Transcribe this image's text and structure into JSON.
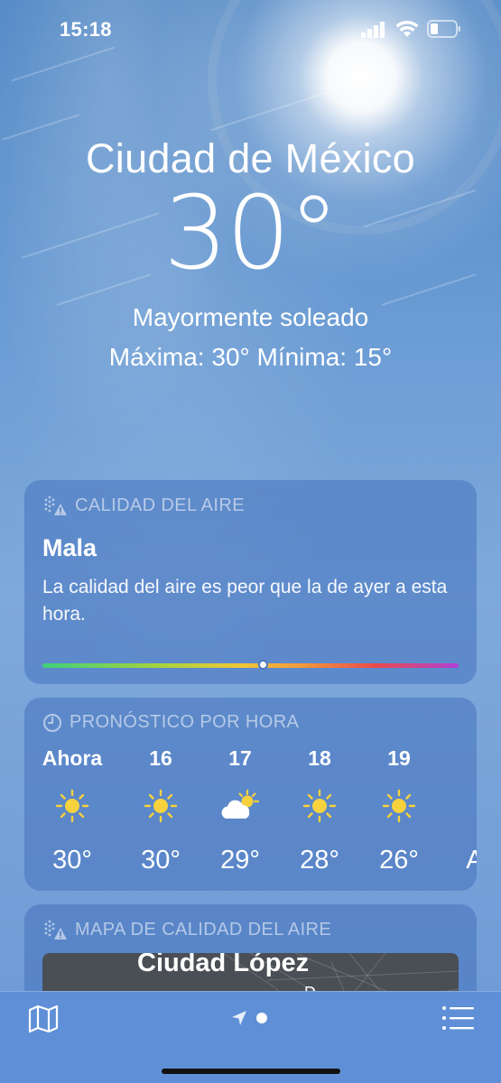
{
  "status_bar": {
    "time": "15:18"
  },
  "location": {
    "city": "Ciudad de México",
    "temperature": "30°",
    "condition": "Mayormente soleado",
    "high_low": "Máxima:  30°  Mínima: 15°"
  },
  "air_quality": {
    "header": "CALIDAD DEL AIRE",
    "level": "Mala",
    "description": "La calidad del aire es peor que la de ayer a esta hora.",
    "scale_position": 0.53
  },
  "hourly": {
    "header": "PRONÓSTICO POR HORA",
    "items": [
      {
        "label": "Ahora",
        "icon": "sun-icon",
        "temp": "30°"
      },
      {
        "label": "16",
        "icon": "sun-icon",
        "temp": "30°"
      },
      {
        "label": "17",
        "icon": "partly-cloudy-icon",
        "temp": "29°"
      },
      {
        "label": "18",
        "icon": "sun-icon",
        "temp": "28°"
      },
      {
        "label": "19",
        "icon": "sun-icon",
        "temp": "26°"
      },
      {
        "label": "",
        "icon": "",
        "temp": "At"
      }
    ]
  },
  "aq_map": {
    "header": "MAPA DE CALIDAD DEL AIRE",
    "city_label": "Ciudad López",
    "secondary_label": "D"
  },
  "colors": {
    "card_bg": "#4673be",
    "bottom_bar": "#5f8fd6"
  }
}
